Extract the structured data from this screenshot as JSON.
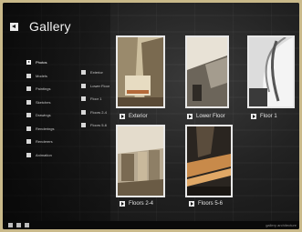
{
  "header": {
    "title": "Gallery"
  },
  "nav": {
    "col1": [
      "Photos",
      "Models",
      "Paintings",
      "Sketches",
      "Drawings",
      "Renderings",
      "Renderers",
      "Animation"
    ],
    "col2": [
      "Exterior",
      "Lower Floor",
      "Floor 1",
      "Floors 2-4",
      "Floors 5-6"
    ],
    "active": "Photos"
  },
  "thumbnails": [
    {
      "caption": "Exterior"
    },
    {
      "caption": "Lower Floor"
    },
    {
      "caption": "Floor 1"
    },
    {
      "caption": "Floors 2-4"
    },
    {
      "caption": "Floors 5-6"
    }
  ],
  "footer": {
    "brand": "gallery architecture"
  },
  "colors": {
    "background": "#131313",
    "outer": "#c9b98a",
    "frame_border": "#e8e8e8",
    "text": "#f2f2f2"
  }
}
